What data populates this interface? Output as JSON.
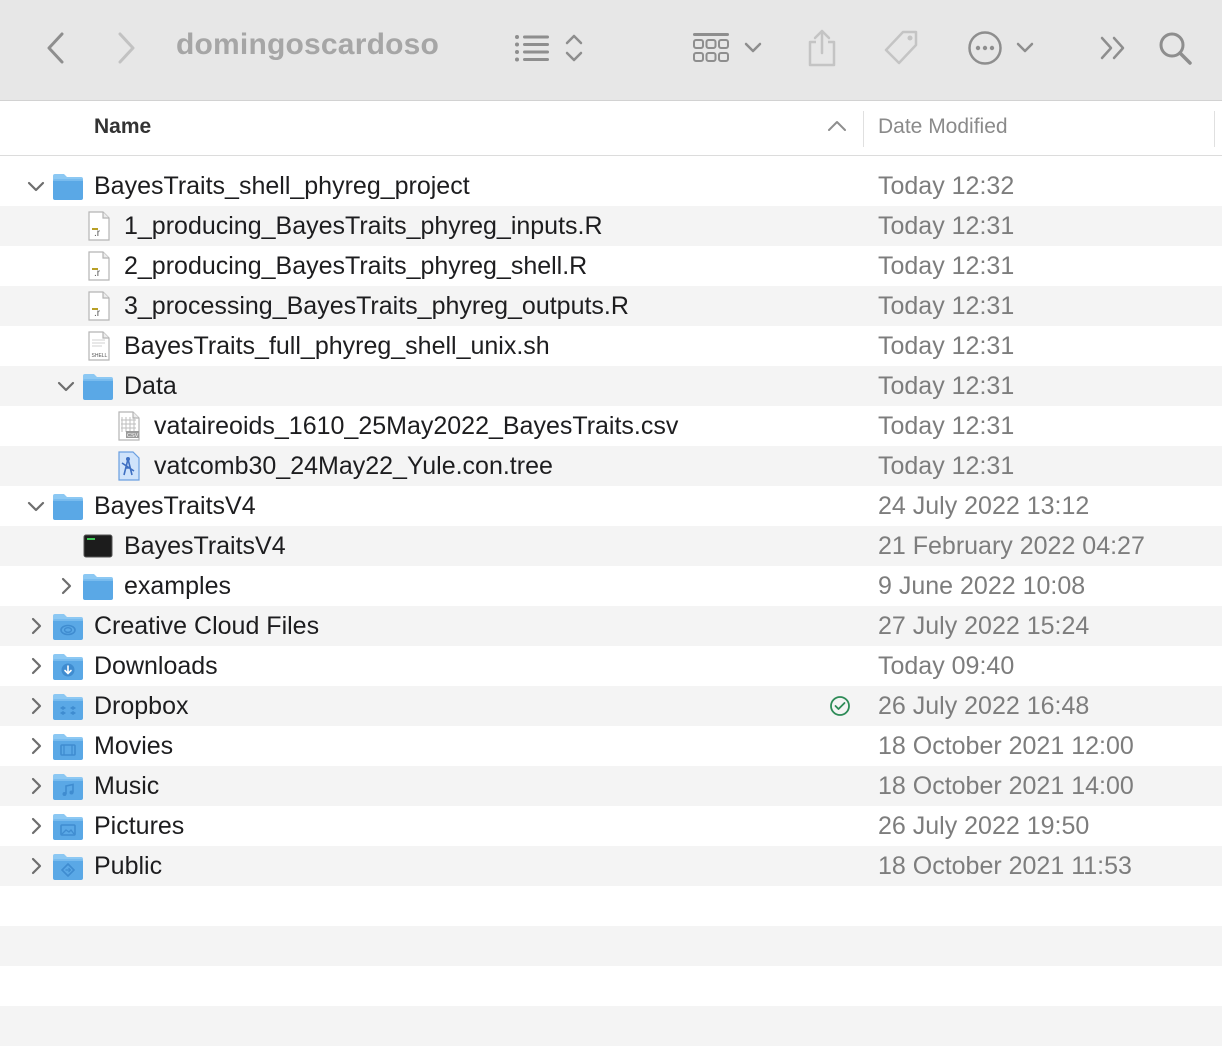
{
  "window": {
    "title": "domingoscardoso",
    "colors": {
      "toolbar": "#e7e7e7",
      "icon": "#8e8e8e",
      "folder": "#5aa8e6",
      "sync_ok": "#2e8b57"
    }
  },
  "toolbar": {
    "icons": [
      "chevron-left-icon",
      "chevron-right-icon",
      "list-view-icon",
      "sort-updown-icon",
      "group-grid-icon",
      "chevron-down-icon",
      "share-icon",
      "tag-icon",
      "ellipsis-circle-icon",
      "chevron-down-icon",
      "double-chevron-right-icon",
      "search-icon"
    ]
  },
  "columns": {
    "name": "Name",
    "date_modified": "Date Modified",
    "sort": "ascending"
  },
  "rows": [
    {
      "name": "BayesTraits_shell_phyreg_project",
      "date": "Today 12:32",
      "level": 0,
      "kind": "folder",
      "disclosure": "open"
    },
    {
      "name": "1_producing_BayesTraits_phyreg_inputs.R",
      "date": "Today 12:31",
      "level": 1,
      "kind": "r-file",
      "disclosure": "none"
    },
    {
      "name": "2_producing_BayesTraits_phyreg_shell.R",
      "date": "Today 12:31",
      "level": 1,
      "kind": "r-file",
      "disclosure": "none"
    },
    {
      "name": "3_processing_BayesTraits_phyreg_outputs.R",
      "date": "Today 12:31",
      "level": 1,
      "kind": "r-file",
      "disclosure": "none"
    },
    {
      "name": "BayesTraits_full_phyreg_shell_unix.sh",
      "date": "Today 12:31",
      "level": 1,
      "kind": "shell-file",
      "disclosure": "none"
    },
    {
      "name": "Data",
      "date": "Today 12:31",
      "level": 1,
      "kind": "folder",
      "disclosure": "open"
    },
    {
      "name": "vataireoids_1610_25May2022_BayesTraits.csv",
      "date": "Today 12:31",
      "level": 2,
      "kind": "csv-file",
      "disclosure": "none"
    },
    {
      "name": "vatcomb30_24May22_Yule.con.tree",
      "date": "Today 12:31",
      "level": 2,
      "kind": "tree-file",
      "disclosure": "none"
    },
    {
      "name": "BayesTraitsV4",
      "date": "24 July 2022 13:12",
      "level": 0,
      "kind": "folder",
      "disclosure": "open"
    },
    {
      "name": "BayesTraitsV4",
      "date": "21 February 2022 04:27",
      "level": 1,
      "kind": "executable",
      "disclosure": "none"
    },
    {
      "name": "examples",
      "date": "9 June 2022 10:08",
      "level": 1,
      "kind": "folder",
      "disclosure": "closed"
    },
    {
      "name": "Creative Cloud Files",
      "date": "27 July 2022 15:24",
      "level": 0,
      "kind": "folder-creative-cloud",
      "disclosure": "closed"
    },
    {
      "name": "Downloads",
      "date": "Today 09:40",
      "level": 0,
      "kind": "folder-downloads",
      "disclosure": "closed"
    },
    {
      "name": "Dropbox",
      "date": "26 July 2022 16:48",
      "level": 0,
      "kind": "folder-dropbox",
      "disclosure": "closed",
      "sync": "synced"
    },
    {
      "name": "Movies",
      "date": "18 October 2021 12:00",
      "level": 0,
      "kind": "folder-movies",
      "disclosure": "closed"
    },
    {
      "name": "Music",
      "date": "18 October 2021 14:00",
      "level": 0,
      "kind": "folder-music",
      "disclosure": "closed"
    },
    {
      "name": "Pictures",
      "date": "26 July 2022 19:50",
      "level": 0,
      "kind": "folder-pictures",
      "disclosure": "closed"
    },
    {
      "name": "Public",
      "date": "18 October 2021 11:53",
      "level": 0,
      "kind": "folder-public",
      "disclosure": "closed"
    }
  ]
}
